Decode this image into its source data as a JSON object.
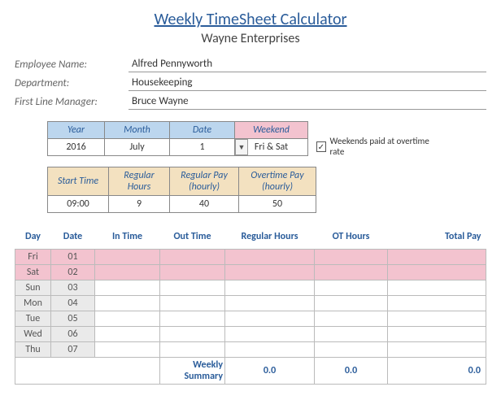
{
  "title": "Weekly TimeSheet Calculator",
  "company": "Wayne Enterprises",
  "info": {
    "employee_label": "Employee Name:",
    "employee_value": "Alfred Pennyworth",
    "department_label": "Department:",
    "department_value": "Housekeeping",
    "manager_label": "First Line Manager:",
    "manager_value": "Bruce Wayne"
  },
  "period": {
    "headers": {
      "year": "Year",
      "month": "Month",
      "date": "Date",
      "weekend": "Weekend"
    },
    "values": {
      "year": "2016",
      "month": "July",
      "date": "1",
      "weekend": "Fri & Sat"
    }
  },
  "overtime_check": {
    "label": "Weekends paid at overtime rate",
    "checked": "✓"
  },
  "rates": {
    "headers": {
      "start": "Start Time",
      "reg_hours": "Regular Hours",
      "reg_pay": "Regular Pay (hourly)",
      "ot_pay": "Overtime Pay (hourly)"
    },
    "values": {
      "start": "09:00",
      "reg_hours": "9",
      "reg_pay": "40",
      "ot_pay": "50"
    }
  },
  "columns": {
    "day": "Day",
    "date": "Date",
    "in": "In Time",
    "out": "Out Time",
    "reg": "Regular Hours",
    "ot": "OT Hours",
    "total": "Total Pay"
  },
  "rows": [
    {
      "day": "Fri",
      "date": "01",
      "weekend": true
    },
    {
      "day": "Sat",
      "date": "02",
      "weekend": true
    },
    {
      "day": "Sun",
      "date": "03",
      "weekend": false
    },
    {
      "day": "Mon",
      "date": "04",
      "weekend": false
    },
    {
      "day": "Tue",
      "date": "05",
      "weekend": false
    },
    {
      "day": "Wed",
      "date": "06",
      "weekend": false
    },
    {
      "day": "Thu",
      "date": "07",
      "weekend": false
    }
  ],
  "summary": {
    "label": "Weekly Summary",
    "reg": "0.0",
    "ot": "0.0",
    "total": "0.0"
  }
}
